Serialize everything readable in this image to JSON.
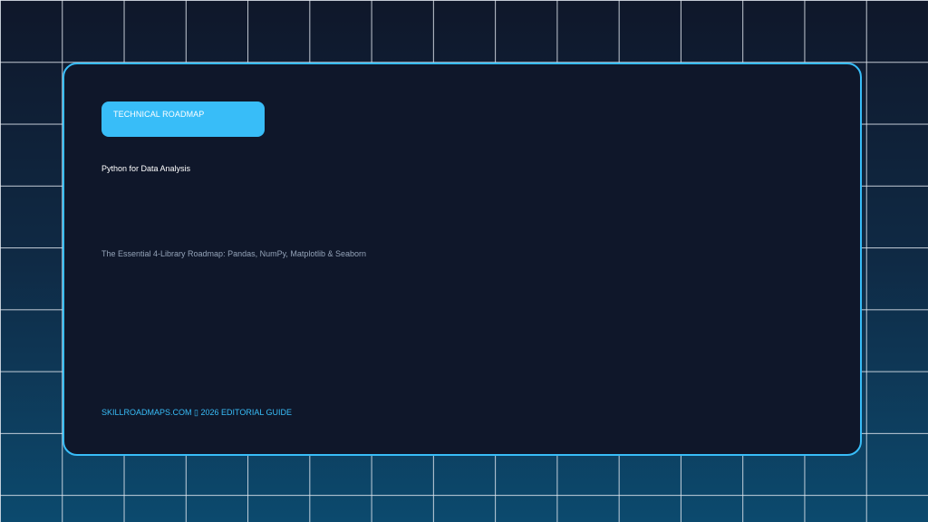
{
  "badge": {
    "label": "TECHNICAL ROADMAP"
  },
  "header": {
    "title": "Python for Data Analysis",
    "subtitle": "The Essential 4-Library Roadmap: Pandas, NumPy, Matplotlib & Seaborn"
  },
  "footer": {
    "text": "SKILLROADMAPS.COM ▯ 2026 EDITORIAL GUIDE"
  },
  "colors": {
    "accent": "#38bdf8",
    "card_background": "#0f172a",
    "muted_text": "#94a3b8",
    "primary_text": "#ffffff"
  }
}
